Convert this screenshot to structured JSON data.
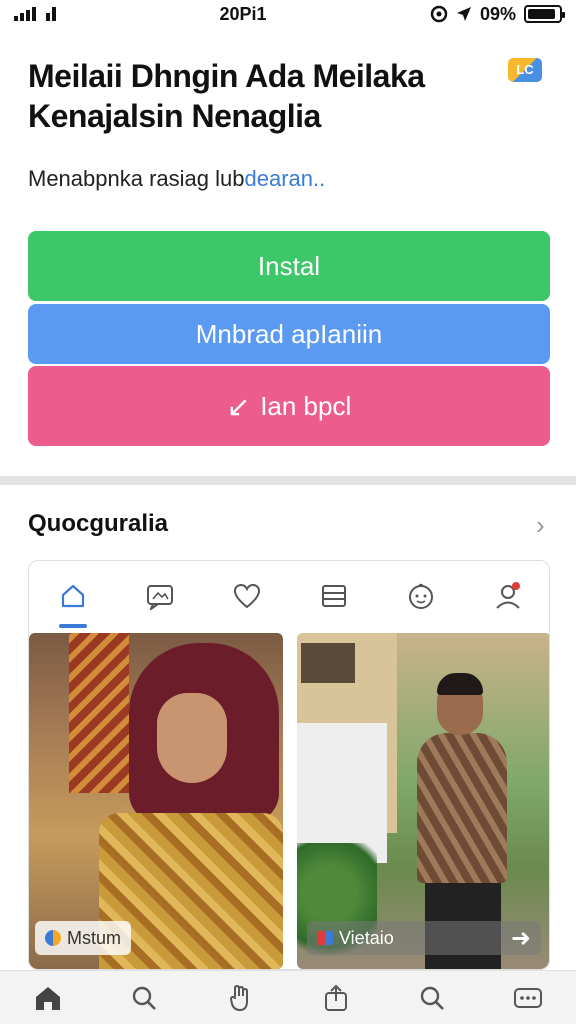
{
  "status_bar": {
    "time": "20Pi1",
    "battery_text": "09%",
    "battery_level": 0.9
  },
  "header": {
    "headline_line1": "Meilaii Dhngin Ada  Meilaka",
    "headline_line2": "Kenajalsin Nenaglia",
    "app_icon_text": "LC"
  },
  "subtitle": {
    "text": "Menabpnka rasiag lub",
    "link": "dearan.."
  },
  "buttons": {
    "install": "Instal",
    "open": "Mnbrad apIaniin",
    "share_arrow": "↙",
    "share": "Ian bpcl"
  },
  "section": {
    "title": "Quocguralia",
    "chevron": "›"
  },
  "tabs": [
    {
      "icon": "home-icon",
      "active": true
    },
    {
      "icon": "chat-image-icon",
      "active": false
    },
    {
      "icon": "heart-icon",
      "active": false
    },
    {
      "icon": "list-icon",
      "active": false
    },
    {
      "icon": "baby-face-icon",
      "active": false
    },
    {
      "icon": "person-notification-icon",
      "active": false
    }
  ],
  "photos": [
    {
      "caption": "Mstum"
    },
    {
      "caption": "Vietaio",
      "nav": "➜"
    }
  ],
  "bottom_nav": [
    "home-icon",
    "search-icon",
    "hand-icon",
    "share-icon",
    "search-icon",
    "more-icon"
  ],
  "colors": {
    "green": "#3ec768",
    "blue": "#5b9af2",
    "pink": "#ec5d8d",
    "accent": "#3b7bd8"
  }
}
